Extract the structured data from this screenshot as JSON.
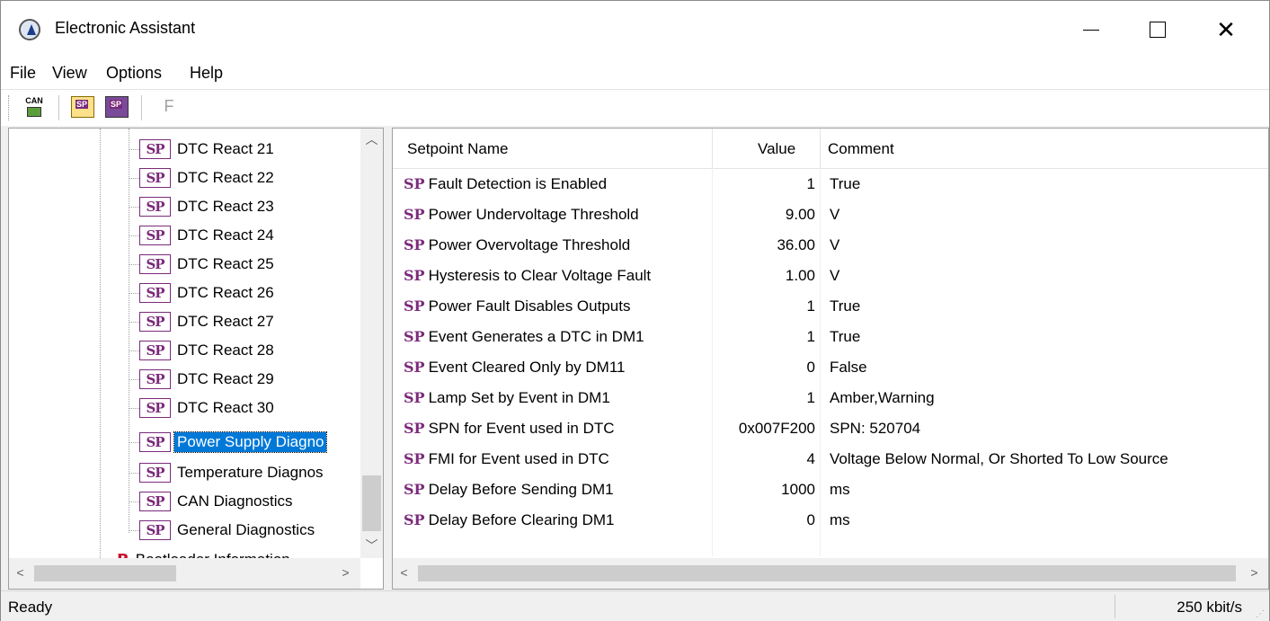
{
  "window": {
    "title": "Electronic Assistant"
  },
  "menu": [
    "File",
    "View",
    "Options",
    "Help"
  ],
  "toolbar": {
    "can_label": "CAN",
    "open_label": "SP",
    "save_label": "SP",
    "f_label": "F"
  },
  "tree": {
    "items": [
      {
        "label": "DTC React 21",
        "icon": "SP"
      },
      {
        "label": "DTC React 22",
        "icon": "SP"
      },
      {
        "label": "DTC React 23",
        "icon": "SP"
      },
      {
        "label": "DTC React 24",
        "icon": "SP"
      },
      {
        "label": "DTC React 25",
        "icon": "SP"
      },
      {
        "label": "DTC React 26",
        "icon": "SP"
      },
      {
        "label": "DTC React 27",
        "icon": "SP"
      },
      {
        "label": "DTC React 28",
        "icon": "SP"
      },
      {
        "label": "DTC React 29",
        "icon": "SP"
      },
      {
        "label": "DTC React 30",
        "icon": "SP"
      },
      {
        "label": "Power Supply Diagno",
        "icon": "SP",
        "selected": true
      },
      {
        "label": "Temperature Diagnos",
        "icon": "SP"
      },
      {
        "label": "CAN Diagnostics",
        "icon": "SP"
      },
      {
        "label": "General Diagnostics",
        "icon": "SP"
      }
    ],
    "bootloader": {
      "label": "Bootloader Information",
      "icon": "B"
    }
  },
  "list": {
    "headers": {
      "name": "Setpoint Name",
      "value": "Value",
      "comment": "Comment"
    },
    "tag": "SP",
    "rows": [
      {
        "name": "Fault Detection is Enabled",
        "value": "1",
        "comment": "True"
      },
      {
        "name": "Power Undervoltage Threshold",
        "value": "9.00",
        "comment": "V"
      },
      {
        "name": "Power Overvoltage Threshold",
        "value": "36.00",
        "comment": "V"
      },
      {
        "name": "Hysteresis to Clear Voltage Fault",
        "value": "1.00",
        "comment": "V"
      },
      {
        "name": "Power Fault Disables Outputs",
        "value": "1",
        "comment": "True"
      },
      {
        "name": "Event Generates a DTC in DM1",
        "value": "1",
        "comment": "True"
      },
      {
        "name": "Event Cleared Only by DM11",
        "value": "0",
        "comment": "False"
      },
      {
        "name": "Lamp Set by Event in DM1",
        "value": "1",
        "comment": "Amber,Warning"
      },
      {
        "name": "SPN for Event used in DTC",
        "value": "0x007F200",
        "comment": "SPN: 520704"
      },
      {
        "name": "FMI for Event used in DTC",
        "value": "4",
        "comment": "Voltage Below Normal, Or Shorted To Low Source"
      },
      {
        "name": "Delay Before Sending DM1",
        "value": "1000",
        "comment": "ms"
      },
      {
        "name": "Delay Before Clearing DM1",
        "value": "0",
        "comment": "ms"
      }
    ]
  },
  "status": {
    "left": "Ready",
    "right": "250 kbit/s"
  },
  "colors": {
    "selection": "#0078d7",
    "sp_tag": "#7b2a7b",
    "bootloader": "#c8102e"
  }
}
